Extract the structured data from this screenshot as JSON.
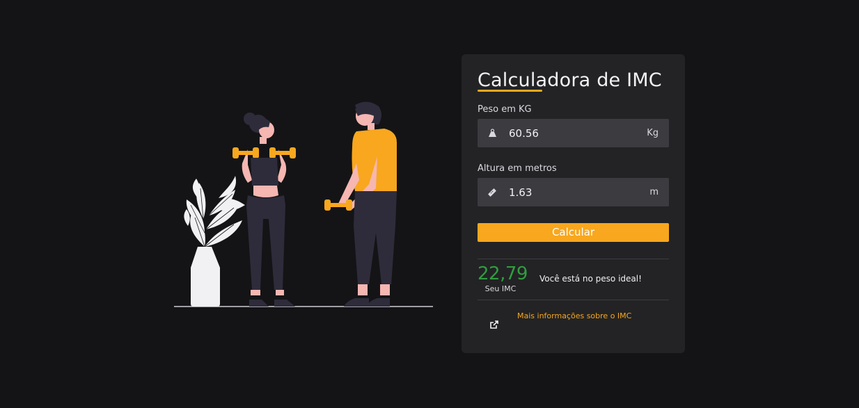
{
  "illustration": {
    "icon": "fitness-people-illustration"
  },
  "card": {
    "title": "Calculadora de IMC",
    "weight": {
      "label": "Peso em KG",
      "value": "60.56",
      "unit": "Kg",
      "icon": "weight-icon"
    },
    "height": {
      "label": "Altura em metros",
      "value": "1.63",
      "unit": "m",
      "icon": "ruler-icon"
    },
    "calculate_label": "Calcular",
    "result": {
      "value": "22,79",
      "label": "Seu IMC",
      "message": "Você está no peso ideal!",
      "value_color": "#2f9e3f"
    },
    "more_info": {
      "label": "Mais informações sobre o IMC",
      "icon": "external-link-icon"
    }
  },
  "colors": {
    "accent": "#f8a71e",
    "background": "#141416",
    "card": "#232325",
    "input": "#3b3b40",
    "success": "#2f9e3f"
  }
}
